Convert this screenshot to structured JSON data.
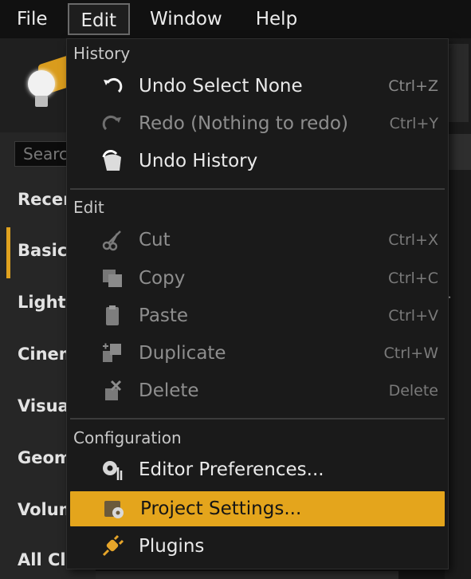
{
  "menubar": {
    "items": [
      {
        "label": "File"
      },
      {
        "label": "Edit"
      },
      {
        "label": "Window"
      },
      {
        "label": "Help"
      }
    ]
  },
  "background": {
    "search_placeholder": "Search",
    "categories": [
      "Recent",
      "Basic",
      "Lights",
      "Cinematic",
      "Visual",
      "Geometry",
      "Volumes",
      "All Classes"
    ]
  },
  "edit_menu": {
    "sections": [
      {
        "header": "History",
        "items": [
          {
            "label": "Undo Select None",
            "shortcut": "Ctrl+Z",
            "icon": "undo-icon",
            "enabled": true
          },
          {
            "label": "Redo (Nothing to redo)",
            "shortcut": "Ctrl+Y",
            "icon": "redo-icon",
            "enabled": false
          },
          {
            "label": "Undo History",
            "shortcut": "",
            "icon": "undo-history-icon",
            "enabled": true
          }
        ]
      },
      {
        "header": "Edit",
        "items": [
          {
            "label": "Cut",
            "shortcut": "Ctrl+X",
            "icon": "scissors-icon",
            "enabled": false
          },
          {
            "label": "Copy",
            "shortcut": "Ctrl+C",
            "icon": "copy-icon",
            "enabled": false
          },
          {
            "label": "Paste",
            "shortcut": "Ctrl+V",
            "icon": "paste-icon",
            "enabled": false
          },
          {
            "label": "Duplicate",
            "shortcut": "Ctrl+W",
            "icon": "duplicate-icon",
            "enabled": false
          },
          {
            "label": "Delete",
            "shortcut": "Delete",
            "icon": "delete-icon",
            "enabled": false
          }
        ]
      },
      {
        "header": "Configuration",
        "items": [
          {
            "label": "Editor Preferences...",
            "shortcut": "",
            "icon": "editor-preferences-icon",
            "enabled": true
          },
          {
            "label": "Project Settings...",
            "shortcut": "",
            "icon": "project-settings-icon",
            "enabled": true,
            "highlighted": true
          },
          {
            "label": "Plugins",
            "shortcut": "",
            "icon": "plugins-icon",
            "enabled": true
          }
        ]
      }
    ]
  },
  "colors": {
    "highlight": "#e4a51c",
    "menu_bg": "#1a1a1a",
    "disabled_text": "#8e8e8e"
  }
}
